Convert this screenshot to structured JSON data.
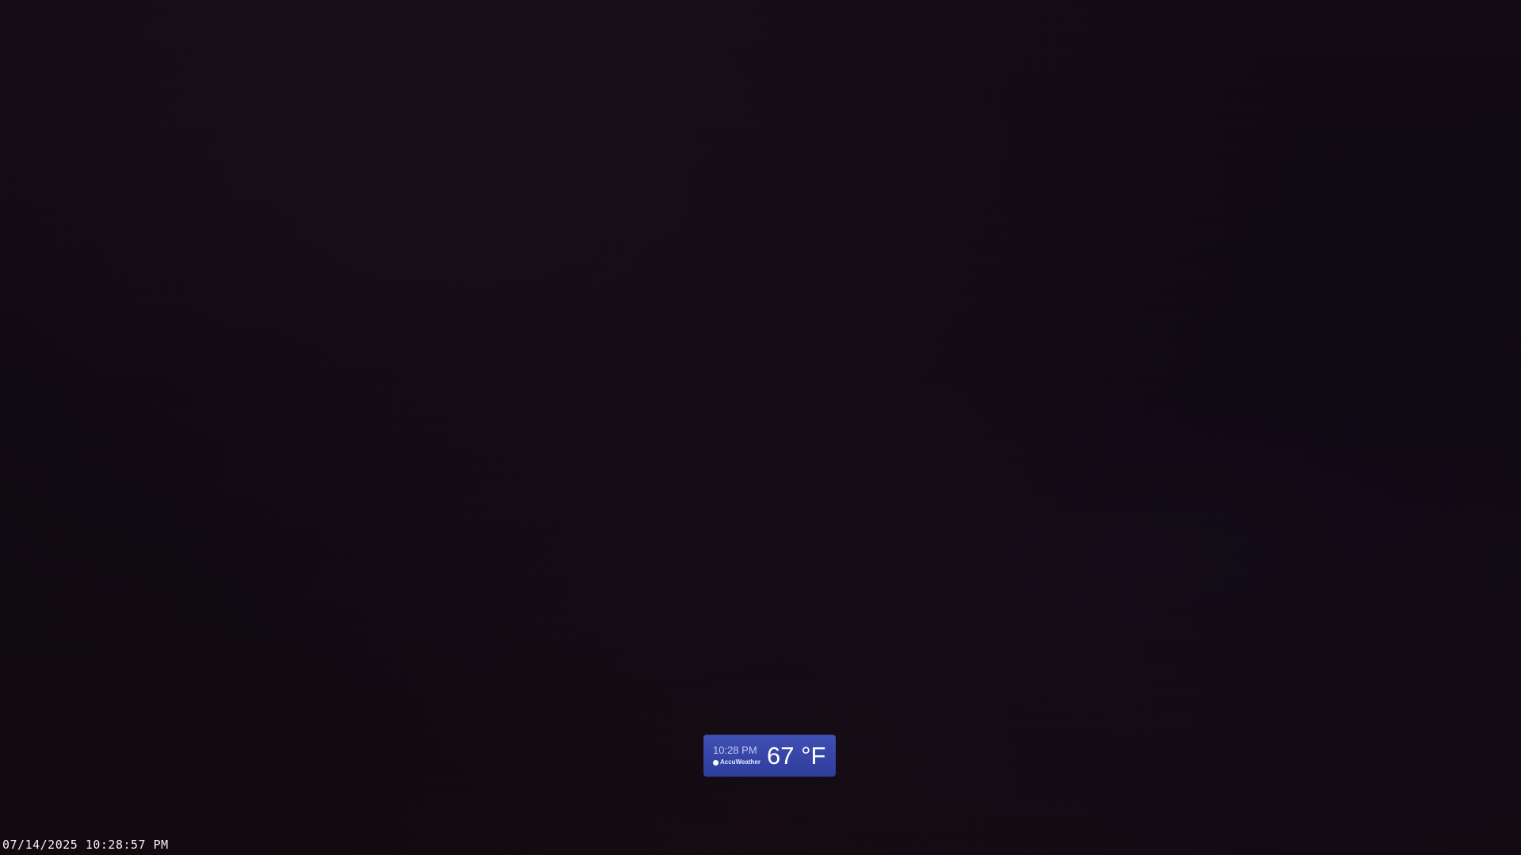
{
  "camera": {
    "timestamp": "07/14/2025 10:28:57 PM"
  },
  "weather_widget": {
    "time": "10:28 PM",
    "brand": "AccuWeather",
    "brand_icon": "accuweather-logo-icon",
    "temperature": "67 °F",
    "background_color": "#3446a8"
  }
}
